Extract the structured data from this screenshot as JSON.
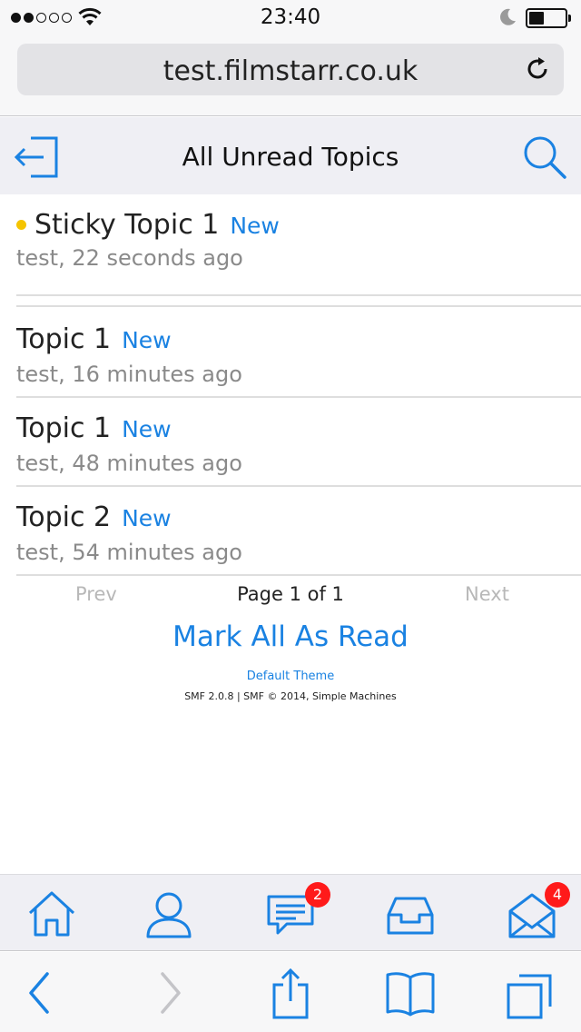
{
  "status_bar": {
    "time": "23:40",
    "signal_dots": 5,
    "signal_filled": 2,
    "icons": [
      "signal-dots-icon",
      "wifi-icon",
      "do-not-disturb-moon-icon",
      "battery-icon"
    ],
    "battery_level": 0.35
  },
  "browser": {
    "url": "test.filmstarr.co.uk",
    "reload_icon": "reload-icon"
  },
  "header": {
    "title": "All Unread Topics",
    "back_icon": "logout-icon",
    "search_icon": "search-icon"
  },
  "topics": [
    {
      "name": "Sticky Topic 1",
      "badge": "New",
      "meta": "test, 22 seconds ago",
      "sticky": true
    },
    {
      "name": "Topic 1",
      "badge": "New",
      "meta": "test, 16 minutes ago",
      "sticky": false
    },
    {
      "name": "Topic 1",
      "badge": "New",
      "meta": "test, 48 minutes ago",
      "sticky": false
    },
    {
      "name": "Topic 2",
      "badge": "New",
      "meta": "test, 54 minutes ago",
      "sticky": false
    }
  ],
  "pagination": {
    "prev": "Prev",
    "page_info": "Page 1 of 1",
    "next": "Next"
  },
  "actions": {
    "mark_all_read": "Mark All As Read"
  },
  "footer": {
    "theme": "Default Theme",
    "copyright": "SMF 2.0.8 | SMF © 2014, Simple Machines"
  },
  "app_tabs": {
    "home_icon": "home-icon",
    "profile_icon": "user-icon",
    "messages_icon": "chat-icon",
    "messages_badge": "2",
    "inbox_icon": "inbox-tray-icon",
    "mail_icon": "mail-open-icon",
    "mail_badge": "4"
  },
  "colors": {
    "accent": "#1a82e2",
    "sticky_dot": "#f5c400",
    "badge": "#ff1a1a"
  }
}
